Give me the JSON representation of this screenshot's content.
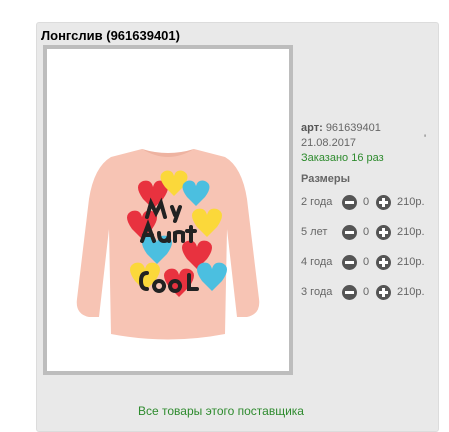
{
  "product": {
    "title": "Лонгслив (961639401)",
    "image_alt": "pink longsleeve with 'My Aunt is très COOL' hearts print",
    "art_label": "арт:",
    "art_value": "961639401",
    "date": "21.08.2017",
    "tick": "'",
    "ordered": "Заказано 16 раз",
    "sizes_heading": "Размеры",
    "sizes": [
      {
        "label": "2 года",
        "qty": "0",
        "price": "210р."
      },
      {
        "label": "5 лет",
        "qty": "0",
        "price": "210р."
      },
      {
        "label": "4 года",
        "qty": "0",
        "price": "210р."
      },
      {
        "label": "3 года",
        "qty": "0",
        "price": "210р."
      }
    ]
  },
  "footer": {
    "all_goods_link": "Все товары этого поставщика"
  },
  "colors": {
    "panel_bg": "#e9e9e9",
    "frame": "#bdbdbd",
    "green_text": "#2e8b2e",
    "button_dark": "#555555",
    "sweater": "#f7c4b4"
  },
  "icons": {
    "minus": "minus-circle-icon",
    "plus": "plus-circle-icon"
  }
}
